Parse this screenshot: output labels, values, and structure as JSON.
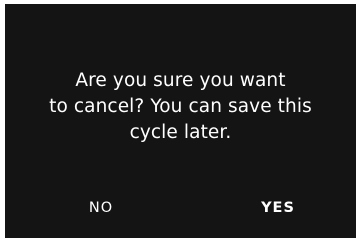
{
  "dialog": {
    "message_lines": [
      "Are you sure you want",
      "to cancel? You can save this",
      "cycle later."
    ],
    "no_label": "NO",
    "yes_label": "YES"
  },
  "colors": {
    "background": "#141414",
    "text": "#ffffff"
  }
}
